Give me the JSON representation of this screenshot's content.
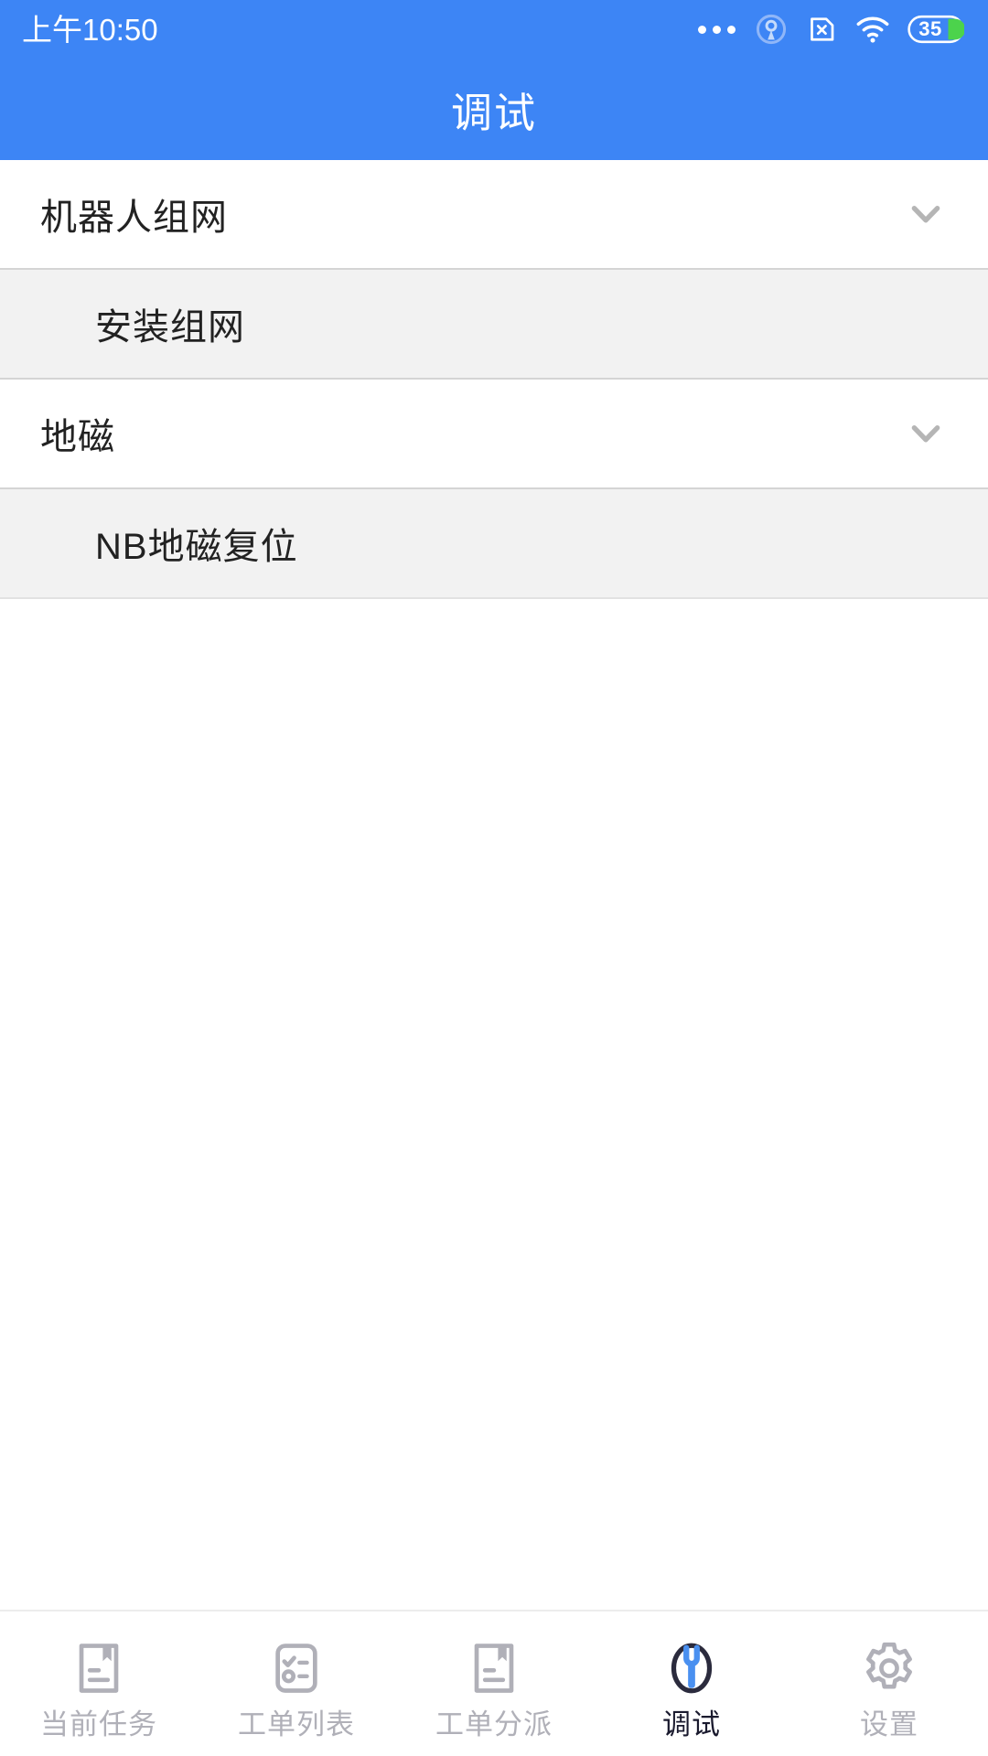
{
  "statusbar": {
    "time": "上午10:50",
    "icons": [
      {
        "name": "more-dots-icon"
      },
      {
        "name": "broadcast-icon"
      },
      {
        "name": "sim-card-disabled-icon"
      },
      {
        "name": "wifi-icon"
      },
      {
        "name": "battery-icon",
        "level": "35"
      }
    ],
    "battery_level": "35"
  },
  "header": {
    "title": "调试"
  },
  "list": {
    "items": [
      {
        "label": "机器人组网",
        "type": "group",
        "expanded": true,
        "chevron": "chevron-down-icon"
      },
      {
        "label": "安装组网",
        "type": "child"
      },
      {
        "label": "地磁",
        "type": "group",
        "expanded": true,
        "chevron": "chevron-down-icon"
      },
      {
        "label": "NB地磁复位",
        "type": "child"
      }
    ]
  },
  "bottomnav": {
    "items": [
      {
        "label": "当前任务",
        "icon": "document-bookmark-icon",
        "active": false
      },
      {
        "label": "工单列表",
        "icon": "checklist-icon",
        "active": false
      },
      {
        "label": "工单分派",
        "icon": "document-bookmark-icon",
        "active": false
      },
      {
        "label": "调试",
        "icon": "wrench-circle-icon",
        "active": true
      },
      {
        "label": "设置",
        "icon": "gear-icon",
        "active": false
      }
    ]
  },
  "colors": {
    "brand_blue": "#3d85f5",
    "accent_blue": "#4a90f0",
    "row_child_bg": "#f2f2f2",
    "nav_inactive": "#b0b0b8",
    "nav_active": "#1a1a2e",
    "battery_green": "#4cd34c"
  }
}
